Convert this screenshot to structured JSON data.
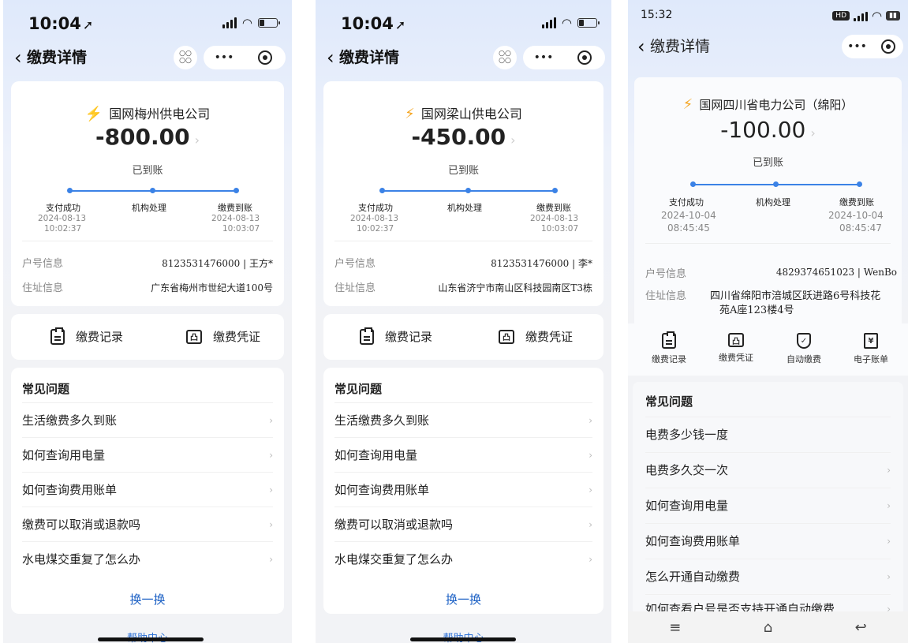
{
  "screens": [
    {
      "status_time": "10:04",
      "nav_title": "缴费详情",
      "company": "国网梅州供电公司",
      "amount": "-800.00",
      "state": "已到账",
      "steps": [
        {
          "label": "支付成功",
          "date": "2024-08-13",
          "time": "10:02:37"
        },
        {
          "label": "机构处理"
        },
        {
          "label": "缴费到账",
          "date": "2024-08-13",
          "time": "10:03:07"
        }
      ],
      "account_label": "户号信息",
      "account_value": "8123531476000 | 王方*",
      "address_label": "住址信息",
      "address_value": "广东省梅州市世纪大道100号",
      "actions": [
        "缴费记录",
        "缴费凭证"
      ],
      "faq_title": "常见问题",
      "faq": [
        "生活缴费多久到账",
        "如何查询用电量",
        "如何查询费用账单",
        "缴费可以取消或退款吗",
        "水电煤交重复了怎么办"
      ],
      "more": "换一换",
      "help": "帮助中心"
    },
    {
      "status_time": "10:04",
      "nav_title": "缴费详情",
      "company": "国网梁山供电公司",
      "amount": "-450.00",
      "state": "已到账",
      "steps": [
        {
          "label": "支付成功",
          "date": "2024-08-13",
          "time": "10:02:37"
        },
        {
          "label": "机构处理"
        },
        {
          "label": "缴费到账",
          "date": "2024-08-13",
          "time": "10:03:07"
        }
      ],
      "account_label": "户号信息",
      "account_value": "8123531476000 | 李*",
      "address_label": "住址信息",
      "address_value": "山东省济宁市南山区科技园南区T3栋",
      "actions": [
        "缴费记录",
        "缴费凭证"
      ],
      "faq_title": "常见问题",
      "faq": [
        "生活缴费多久到账",
        "如何查询用电量",
        "如何查询费用账单",
        "缴费可以取消或退款吗",
        "水电煤交重复了怎么办"
      ],
      "more": "换一换",
      "help": "帮助中心"
    },
    {
      "status_time": "15:32",
      "nav_title": "缴费详情",
      "company": "国网四川省电力公司（绵阳）",
      "amount": "-100.00",
      "state": "已到账",
      "steps": [
        {
          "label": "支付成功",
          "date": "2024-10-04",
          "time": "08:45:45"
        },
        {
          "label": "机构处理"
        },
        {
          "label": "缴费到账",
          "date": "2024-10-04",
          "time": "08:45:47"
        }
      ],
      "account_label": "户号信息",
      "account_value": "4829374651023 | WenBo",
      "address_label": "住址信息",
      "address_value_line1": "四川省绵阳市涪城区跃进路6号科技花",
      "address_value_line2": "苑A座123楼4号",
      "actions": [
        "缴费记录",
        "缴费凭证",
        "自动缴费",
        "电子账单"
      ],
      "faq_title": "常见问题",
      "faq": [
        "电费多少钱一度",
        "电费多久交一次",
        "如何查询用电量",
        "如何查询费用账单",
        "怎么开通自动缴费",
        "如何查看户号是否支持开通自动缴费"
      ]
    }
  ],
  "icons": {
    "back": "chevron-left-icon",
    "qr": "mini-program-code-icon",
    "more": "more-dots-icon",
    "close": "target-circle-icon",
    "lightning": "lightning-icon",
    "record": "clipboard-icon",
    "certificate": "certificate-icon",
    "auto": "shield-check-icon",
    "bill": "yen-bill-icon"
  },
  "colors": {
    "accent": "#3b82e6",
    "lightning": "#f5a623",
    "link": "#1a5fc4"
  }
}
